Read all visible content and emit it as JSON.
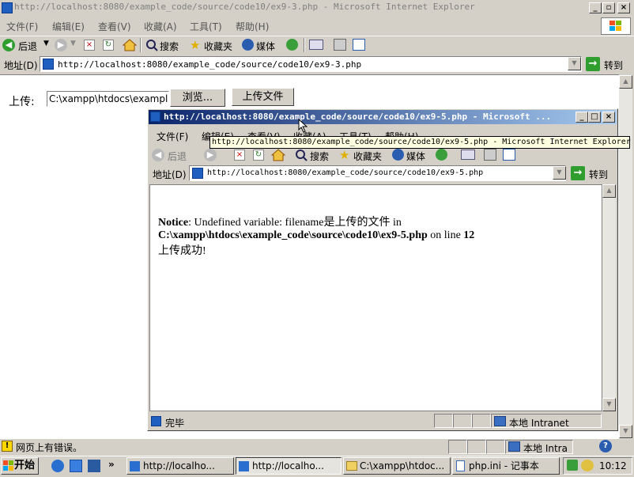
{
  "main_window": {
    "title": "http://localhost:8080/example_code/source/code10/ex9-3.php - Microsoft Internet Explorer",
    "menu": [
      "文件(F)",
      "编辑(E)",
      "查看(V)",
      "收藏(A)",
      "工具(T)",
      "帮助(H)"
    ],
    "toolbar": {
      "back": "后退",
      "search": "搜索",
      "favorites": "收藏夹",
      "media": "媒体"
    },
    "address_label": "地址(D)",
    "address_value": "http://localhost:8080/example_code/source/code10/ex9-3.php",
    "go_label": "转到",
    "form": {
      "upload_label": "上传:",
      "file_value": "C:\\xampp\\htdocs\\example",
      "browse_button": "浏览...",
      "upload_button": "上传文件"
    },
    "status_text": "网页上有错误。",
    "zone": "本地 Intra"
  },
  "popup_window": {
    "title": "http://localhost:8080/example_code/source/code10/ex9-5.php - Microsoft ...",
    "menu": [
      "文件(F)",
      "编辑(E)",
      "查看(V)",
      "收藏(A)",
      "工具(T)",
      "帮助(H)"
    ],
    "toolbar": {
      "back": "后退",
      "search": "搜索",
      "favorites": "收藏夹",
      "media": "媒体"
    },
    "address_label": "地址(D)",
    "address_value": "http://localhost:8080/example_code/source/code10/ex9-5.php",
    "go_label": "转到",
    "tooltip": "http://localhost:8080/example_code/source/code10/ex9-5.php - Microsoft Internet Explorer",
    "content": {
      "notice_label": "Notice",
      "notice_message": ": Undefined variable: filename是上传的文件  in",
      "notice_path": "C:\\xampp\\htdocs\\example_code\\source\\code10\\ex9-5.php",
      "notice_line_text": " on line ",
      "notice_line_num": "12",
      "success": "上传成功!"
    },
    "status_text": "完毕",
    "zone": "本地 Intranet"
  },
  "taskbar": {
    "start": "开始",
    "buttons": [
      "http://localho...",
      "http://localho...",
      "C:\\xampp\\htdoc...",
      "php.ini - 记事本"
    ],
    "clock": "10:12"
  },
  "colors": {
    "title_active": "#0a246a",
    "title_gradient_end": "#a6caf0",
    "face": "#d4d0c8"
  }
}
